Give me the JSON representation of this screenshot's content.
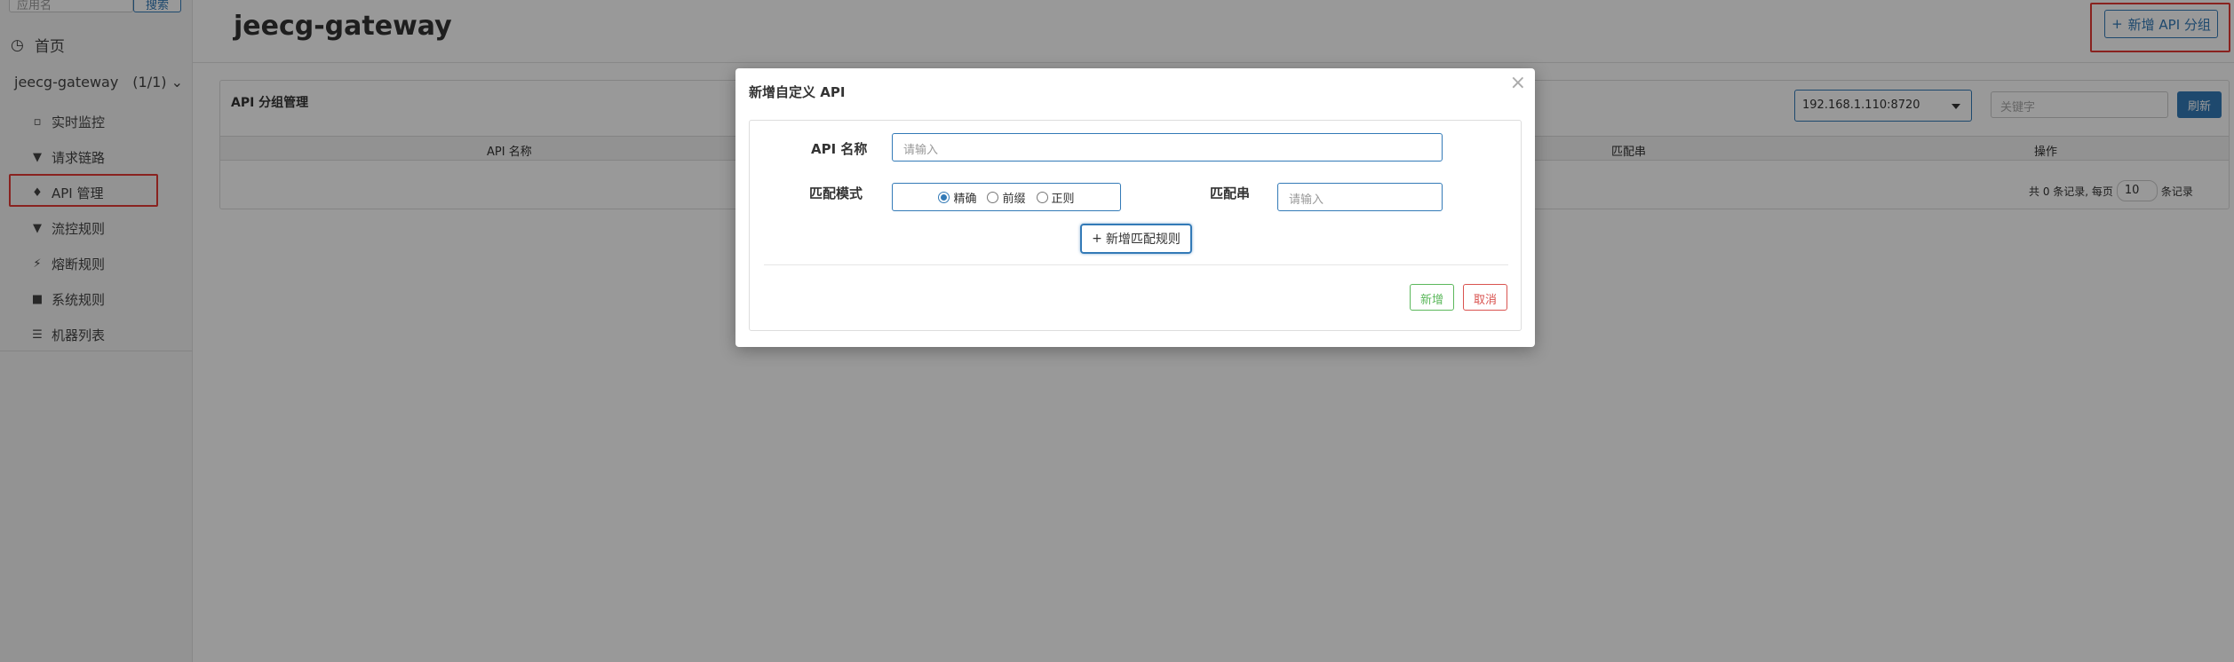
{
  "sidebar": {
    "search_placeholder": "应用名",
    "search_button": "搜索",
    "home": "首页",
    "app_name": "jeecg-gateway",
    "app_count": "(1/1)",
    "items": [
      {
        "label": "实时监控",
        "icon": "bar-chart-icon"
      },
      {
        "label": "请求链路",
        "icon": "filter-icon"
      },
      {
        "label": "API 管理",
        "icon": "tags-icon"
      },
      {
        "label": "流控规则",
        "icon": "filter-icon"
      },
      {
        "label": "熔断规则",
        "icon": "flash-icon"
      },
      {
        "label": "系统规则",
        "icon": "lock-icon"
      },
      {
        "label": "机器列表",
        "icon": "list-icon"
      }
    ]
  },
  "header": {
    "title": "jeecg-gateway",
    "new_group_button": "新增 API 分组"
  },
  "panel": {
    "title": "API 分组管理",
    "machine": "192.168.1.110:8720",
    "keyword_placeholder": "关键字",
    "refresh_button": "刷新",
    "columns": [
      "API 名称",
      "匹配串",
      "操作"
    ],
    "pager": {
      "prefix": "共 0 条记录, 每页",
      "size": "10",
      "suffix": "条记录"
    }
  },
  "modal": {
    "title": "新增自定义 API",
    "close": "×",
    "api_name_label": "API 名称",
    "api_name_placeholder": "请输入",
    "match_mode_label": "匹配模式",
    "modes": [
      "精确",
      "前缀",
      "正则"
    ],
    "selected_mode": "精确",
    "match_string_label": "匹配串",
    "match_string_placeholder": "请输入",
    "add_rule_button": "新增匹配规则",
    "confirm_button": "新增",
    "cancel_button": "取消"
  },
  "colors": {
    "primary": "#337ab7",
    "success": "#5cb85c",
    "danger": "#d9534f",
    "highlight": "#e53935"
  }
}
